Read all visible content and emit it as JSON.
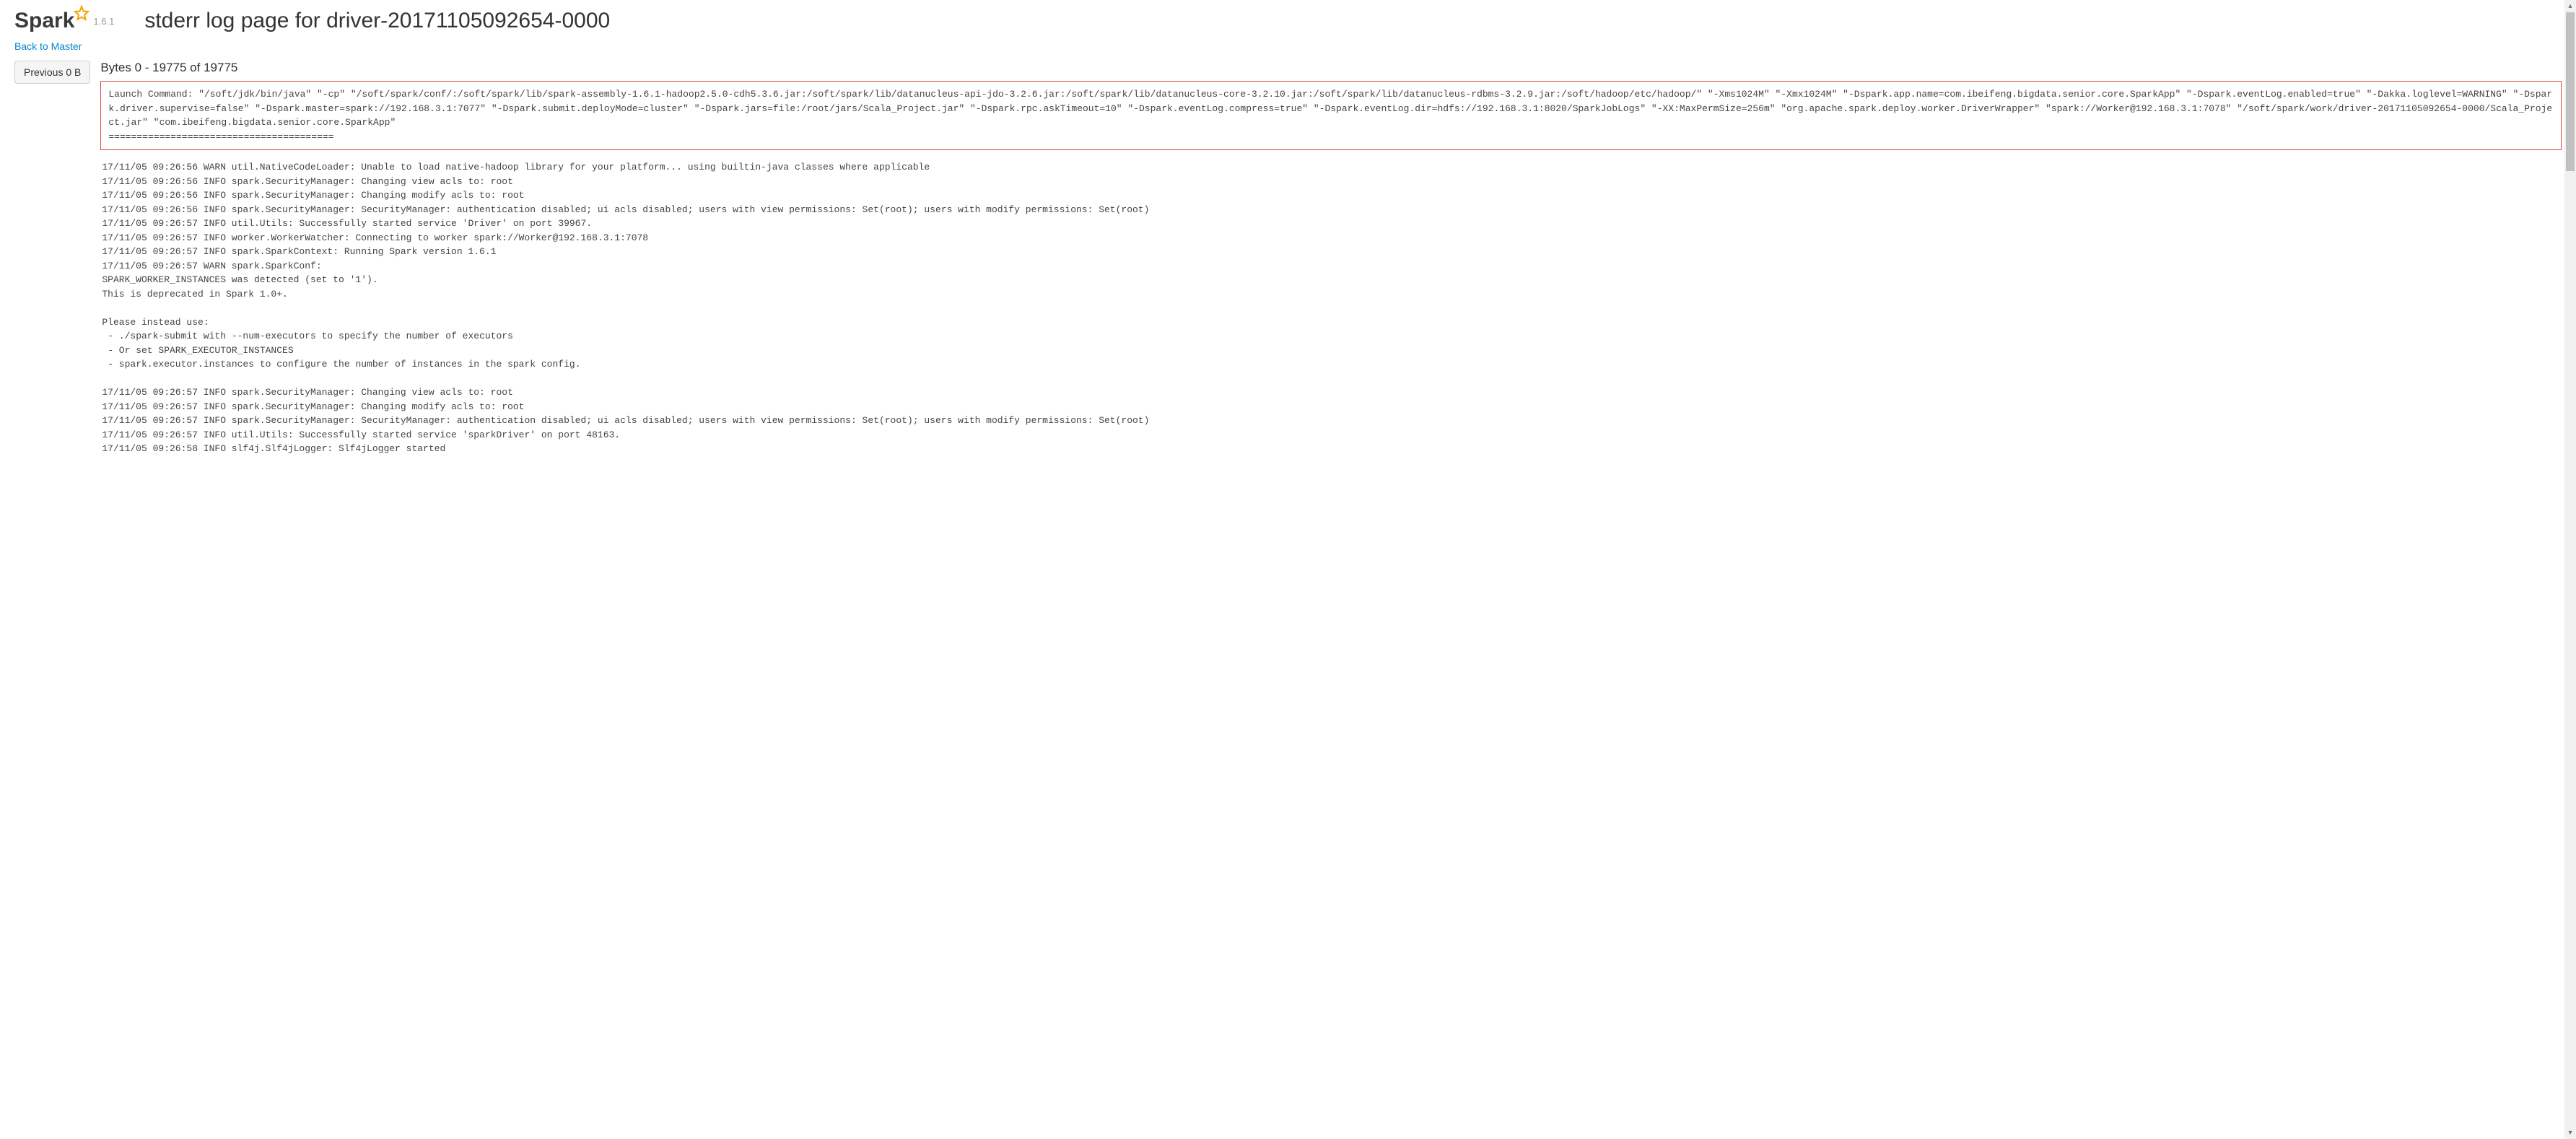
{
  "header": {
    "logo_text": "Spark",
    "version": "1.6.1",
    "title": "stderr log page for driver-20171105092654-0000"
  },
  "nav": {
    "back_link": "Back to Master",
    "previous_btn": "Previous 0 B"
  },
  "log": {
    "byte_range": "Bytes 0 - 19775 of 19775",
    "launch_command": "Launch Command: \"/soft/jdk/bin/java\" \"-cp\" \"/soft/spark/conf/:/soft/spark/lib/spark-assembly-1.6.1-hadoop2.5.0-cdh5.3.6.jar:/soft/spark/lib/datanucleus-api-jdo-3.2.6.jar:/soft/spark/lib/datanucleus-core-3.2.10.jar:/soft/spark/lib/datanucleus-rdbms-3.2.9.jar:/soft/hadoop/etc/hadoop/\" \"-Xms1024M\" \"-Xmx1024M\" \"-Dspark.app.name=com.ibeifeng.bigdata.senior.core.SparkApp\" \"-Dspark.eventLog.enabled=true\" \"-Dakka.loglevel=WARNING\" \"-Dspark.driver.supervise=false\" \"-Dspark.master=spark://192.168.3.1:7077\" \"-Dspark.submit.deployMode=cluster\" \"-Dspark.jars=file:/root/jars/Scala_Project.jar\" \"-Dspark.rpc.askTimeout=10\" \"-Dspark.eventLog.compress=true\" \"-Dspark.eventLog.dir=hdfs://192.168.3.1:8020/SparkJobLogs\" \"-XX:MaxPermSize=256m\" \"org.apache.spark.deploy.worker.DriverWrapper\" \"spark://Worker@192.168.3.1:7078\" \"/soft/spark/work/driver-20171105092654-0000/Scala_Project.jar\" \"com.ibeifeng.bigdata.senior.core.SparkApp\"\n========================================",
    "body": "17/11/05 09:26:56 WARN util.NativeCodeLoader: Unable to load native-hadoop library for your platform... using builtin-java classes where applicable\n17/11/05 09:26:56 INFO spark.SecurityManager: Changing view acls to: root\n17/11/05 09:26:56 INFO spark.SecurityManager: Changing modify acls to: root\n17/11/05 09:26:56 INFO spark.SecurityManager: SecurityManager: authentication disabled; ui acls disabled; users with view permissions: Set(root); users with modify permissions: Set(root)\n17/11/05 09:26:57 INFO util.Utils: Successfully started service 'Driver' on port 39967.\n17/11/05 09:26:57 INFO worker.WorkerWatcher: Connecting to worker spark://Worker@192.168.3.1:7078\n17/11/05 09:26:57 INFO spark.SparkContext: Running Spark version 1.6.1\n17/11/05 09:26:57 WARN spark.SparkConf:\nSPARK_WORKER_INSTANCES was detected (set to '1').\nThis is deprecated in Spark 1.0+.\n\nPlease instead use:\n - ./spark-submit with --num-executors to specify the number of executors\n - Or set SPARK_EXECUTOR_INSTANCES\n - spark.executor.instances to configure the number of instances in the spark config.\n\n17/11/05 09:26:57 INFO spark.SecurityManager: Changing view acls to: root\n17/11/05 09:26:57 INFO spark.SecurityManager: Changing modify acls to: root\n17/11/05 09:26:57 INFO spark.SecurityManager: SecurityManager: authentication disabled; ui acls disabled; users with view permissions: Set(root); users with modify permissions: Set(root)\n17/11/05 09:26:57 INFO util.Utils: Successfully started service 'sparkDriver' on port 48163.\n17/11/05 09:26:58 INFO slf4j.Slf4jLogger: Slf4jLogger started"
  }
}
